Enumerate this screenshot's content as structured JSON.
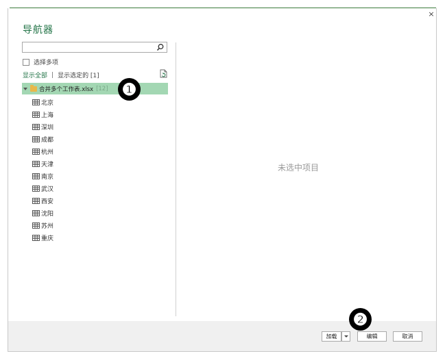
{
  "dialog": {
    "title": "导航器",
    "close_glyph": "×"
  },
  "search": {
    "value": "",
    "placeholder": "",
    "icon": "search-icon"
  },
  "multi_select": {
    "label": "选择多项",
    "checked": false
  },
  "filters": {
    "show_all": "显示全部",
    "separator": "|",
    "show_selected": "显示选定的 [1]"
  },
  "tree": {
    "root": {
      "label": "合并多个工作表.xlsx",
      "count": "[12]",
      "selected": true
    },
    "items": [
      {
        "label": "北京"
      },
      {
        "label": "上海"
      },
      {
        "label": "深圳"
      },
      {
        "label": "成都"
      },
      {
        "label": "杭州"
      },
      {
        "label": "天津"
      },
      {
        "label": "南京"
      },
      {
        "label": "武汉"
      },
      {
        "label": "西安"
      },
      {
        "label": "沈阳"
      },
      {
        "label": "苏州"
      },
      {
        "label": "重庆"
      }
    ]
  },
  "preview": {
    "empty_text": "未选中项目"
  },
  "footer": {
    "load_label": "加载",
    "edit_label": "编辑",
    "cancel_label": "取消"
  },
  "annotations": {
    "badge1": "❶",
    "badge2": "❷"
  },
  "colors": {
    "accent": "#217346",
    "selection": "#a3d7b3",
    "footer_bg": "#f0f0f0"
  }
}
